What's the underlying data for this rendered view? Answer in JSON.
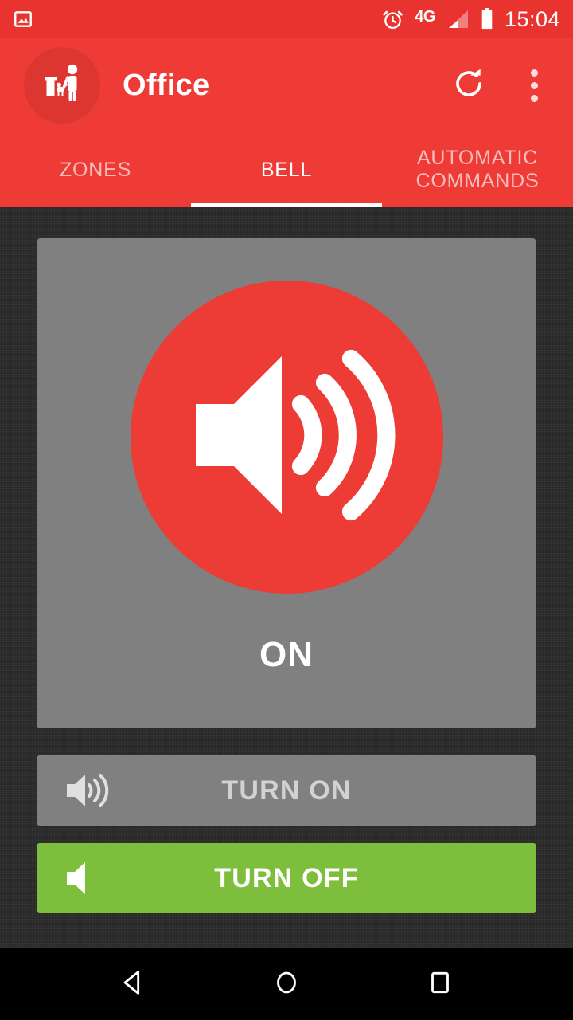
{
  "status_bar": {
    "notification_icon": "image-icon",
    "alarm_icon": "alarm-clock-icon",
    "network_label": "4G",
    "signal_icon": "signal-bars-icon",
    "battery_icon": "battery-icon",
    "time": "15:04",
    "background_color": "#E8332F"
  },
  "app_bar": {
    "logo_icon": "family-pet-logo-icon",
    "title": "Office",
    "refresh_icon": "refresh-icon",
    "overflow_icon": "overflow-menu-icon",
    "background_color": "#EE3B35"
  },
  "tabs": {
    "items": [
      {
        "label": "ZONES",
        "active": false
      },
      {
        "label": "BELL",
        "active": true
      },
      {
        "label": "AUTOMATIC COMMANDS",
        "active": false
      }
    ],
    "active_index": 1,
    "indicator_color": "#FFFFFF"
  },
  "state_card": {
    "icon": "speaker-loud-icon",
    "status_label": "ON",
    "card_color": "#808080",
    "circle_color": "#ED3B35"
  },
  "actions": {
    "turn_on": {
      "label": "TURN ON",
      "icon": "speaker-waves-icon",
      "color": "#808080",
      "enabled": false
    },
    "turn_off": {
      "label": "TURN OFF",
      "icon": "speaker-mute-icon",
      "color": "#7DBF3C",
      "enabled": true
    }
  },
  "nav_bar": {
    "back_icon": "back-triangle-icon",
    "home_icon": "home-circle-icon",
    "recents_icon": "recents-square-icon",
    "background_color": "#000000"
  }
}
